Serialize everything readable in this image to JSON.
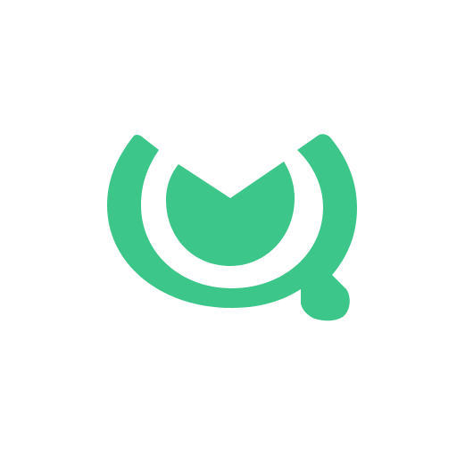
{
  "logo": {
    "icon": "mail-search-logo-icon",
    "color": "#3cc68a",
    "background": "#ffffff"
  }
}
